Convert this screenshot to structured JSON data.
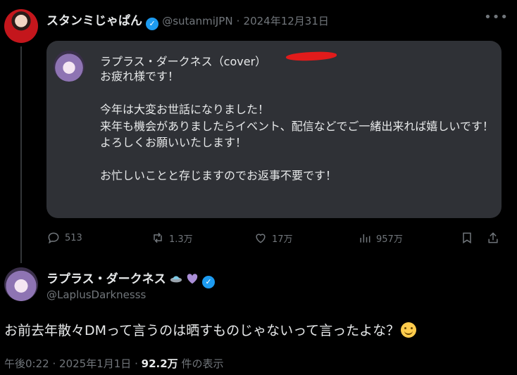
{
  "quoted_tweet": {
    "author_name": "スタンミじゃぱん",
    "handle": "@sutanmiJPN",
    "separator": "·",
    "date": "2024年12月31日",
    "screenshot": {
      "sender_name": "ラプラス・ダークネス（cover）",
      "message": "お疲れ様です！\n\n今年は大変お世話になりました！\n来年も機会がありましたらイベント、配信などでご一緒出来れば嬉しいです！\nよろしくお願いいたします！\n\nお忙しいことと存じますのでお返事不要です！"
    },
    "actions": {
      "replies": "513",
      "reposts": "1.3万",
      "likes": "17万",
      "views": "957万"
    }
  },
  "main_tweet": {
    "author_name": "ラプラス・ダークネス",
    "handle": "@LaplusDarknesss",
    "text": "お前去年散々DMって言うのは晒すものじゃないって言ったよな？",
    "time": "午後0:22",
    "date": "2025年1月1日",
    "separator": "·",
    "view_count": "92.2万",
    "view_label": "件の表示"
  },
  "colors": {
    "background": "#000000",
    "card": "#2f3136",
    "muted": "#71767b",
    "text": "#e7e9ea",
    "verified": "#1d9bf0",
    "redaction": "#e11b1b"
  }
}
